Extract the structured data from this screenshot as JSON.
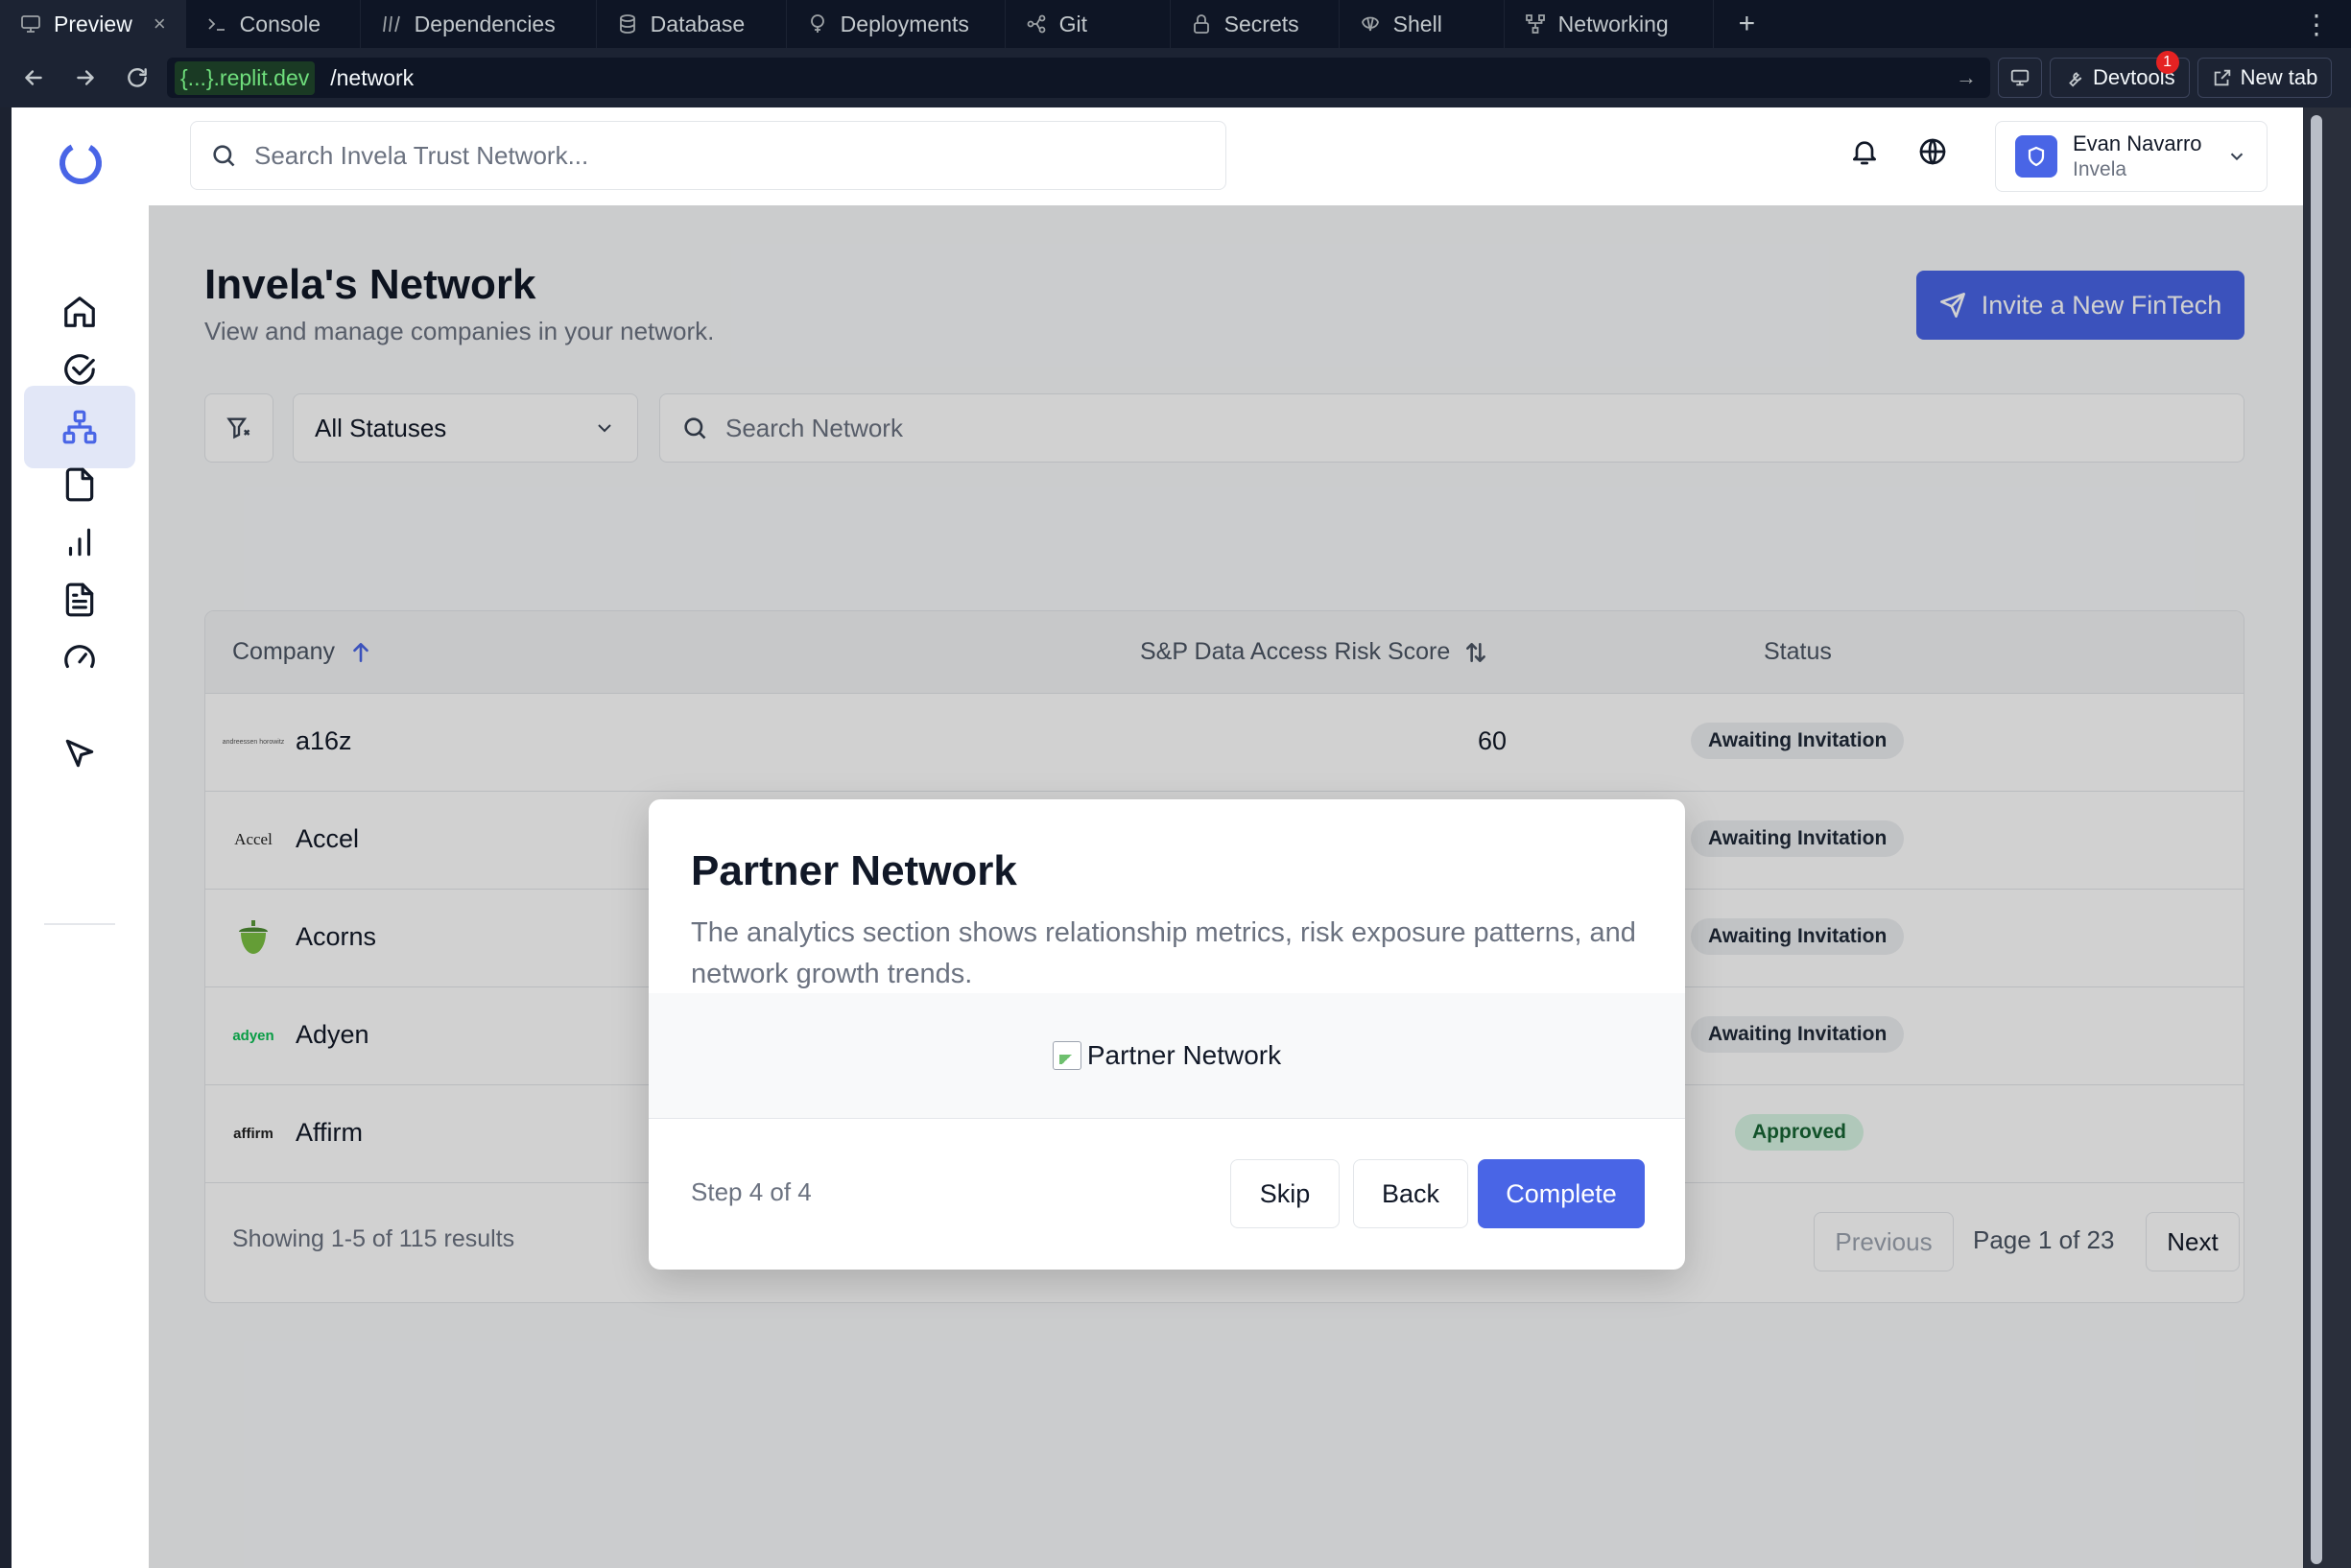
{
  "ide": {
    "tabs": [
      {
        "label": "Preview",
        "icon": "monitor-icon",
        "active": true
      },
      {
        "label": "Console",
        "icon": "terminal-icon"
      },
      {
        "label": "Dependencies",
        "icon": "dependencies-icon"
      },
      {
        "label": "Database",
        "icon": "database-icon"
      },
      {
        "label": "Deployments",
        "icon": "deployments-icon"
      },
      {
        "label": "Git",
        "icon": "git-icon"
      },
      {
        "label": "Secrets",
        "icon": "lock-icon"
      },
      {
        "label": "Shell",
        "icon": "shell-icon"
      },
      {
        "label": "Networking",
        "icon": "networking-icon"
      }
    ],
    "close_glyph": "×",
    "add_glyph": "+",
    "more_glyph": "⋮",
    "url_host": "{...}.replit.dev",
    "url_path": "/network",
    "url_arrow": "→",
    "devtools_label": "Devtools",
    "devtools_badge": "1",
    "new_tab_label": "New tab"
  },
  "header": {
    "search_placeholder": "Search Invela Trust Network...",
    "user_name": "Evan Navarro",
    "user_org": "Invela"
  },
  "page": {
    "title": "Invela's Network",
    "subtitle": "View and manage companies in your network.",
    "invite_label": "Invite a New FinTech",
    "status_filter": "All Statuses",
    "search_placeholder": "Search Network"
  },
  "table": {
    "columns": {
      "company": "Company",
      "score": "S&P Data Access Risk Score",
      "status": "Status"
    },
    "rows": [
      {
        "logo": "andreessen horowitz",
        "name": "a16z",
        "score": "60",
        "status": "Awaiting Invitation"
      },
      {
        "logo": "Accel",
        "name": "Accel",
        "score": "",
        "status": "Awaiting Invitation"
      },
      {
        "logo": "acorn",
        "name": "Acorns",
        "score": "",
        "status": "Awaiting Invitation"
      },
      {
        "logo": "adyen",
        "name": "Adyen",
        "score": "",
        "status": "Awaiting Invitation"
      },
      {
        "logo": "affirm",
        "name": "Affirm",
        "score": "",
        "status": "Approved"
      }
    ],
    "showing": "Showing 1-5 of 115 results",
    "previous_label": "Previous",
    "page_label": "Page 1 of 23",
    "next_label": "Next"
  },
  "modal": {
    "title": "Partner Network",
    "text": "The analytics section shows relationship metrics, risk exposure patterns, and network growth trends.",
    "image_alt": "Partner Network",
    "step": "Step 4 of 4",
    "skip_label": "Skip",
    "back_label": "Back",
    "complete_label": "Complete"
  },
  "colors": {
    "accent": "#4965e6",
    "approved_bg": "#d7f5e3",
    "approved_text": "#166534",
    "awaiting_bg": "#eceef1"
  }
}
